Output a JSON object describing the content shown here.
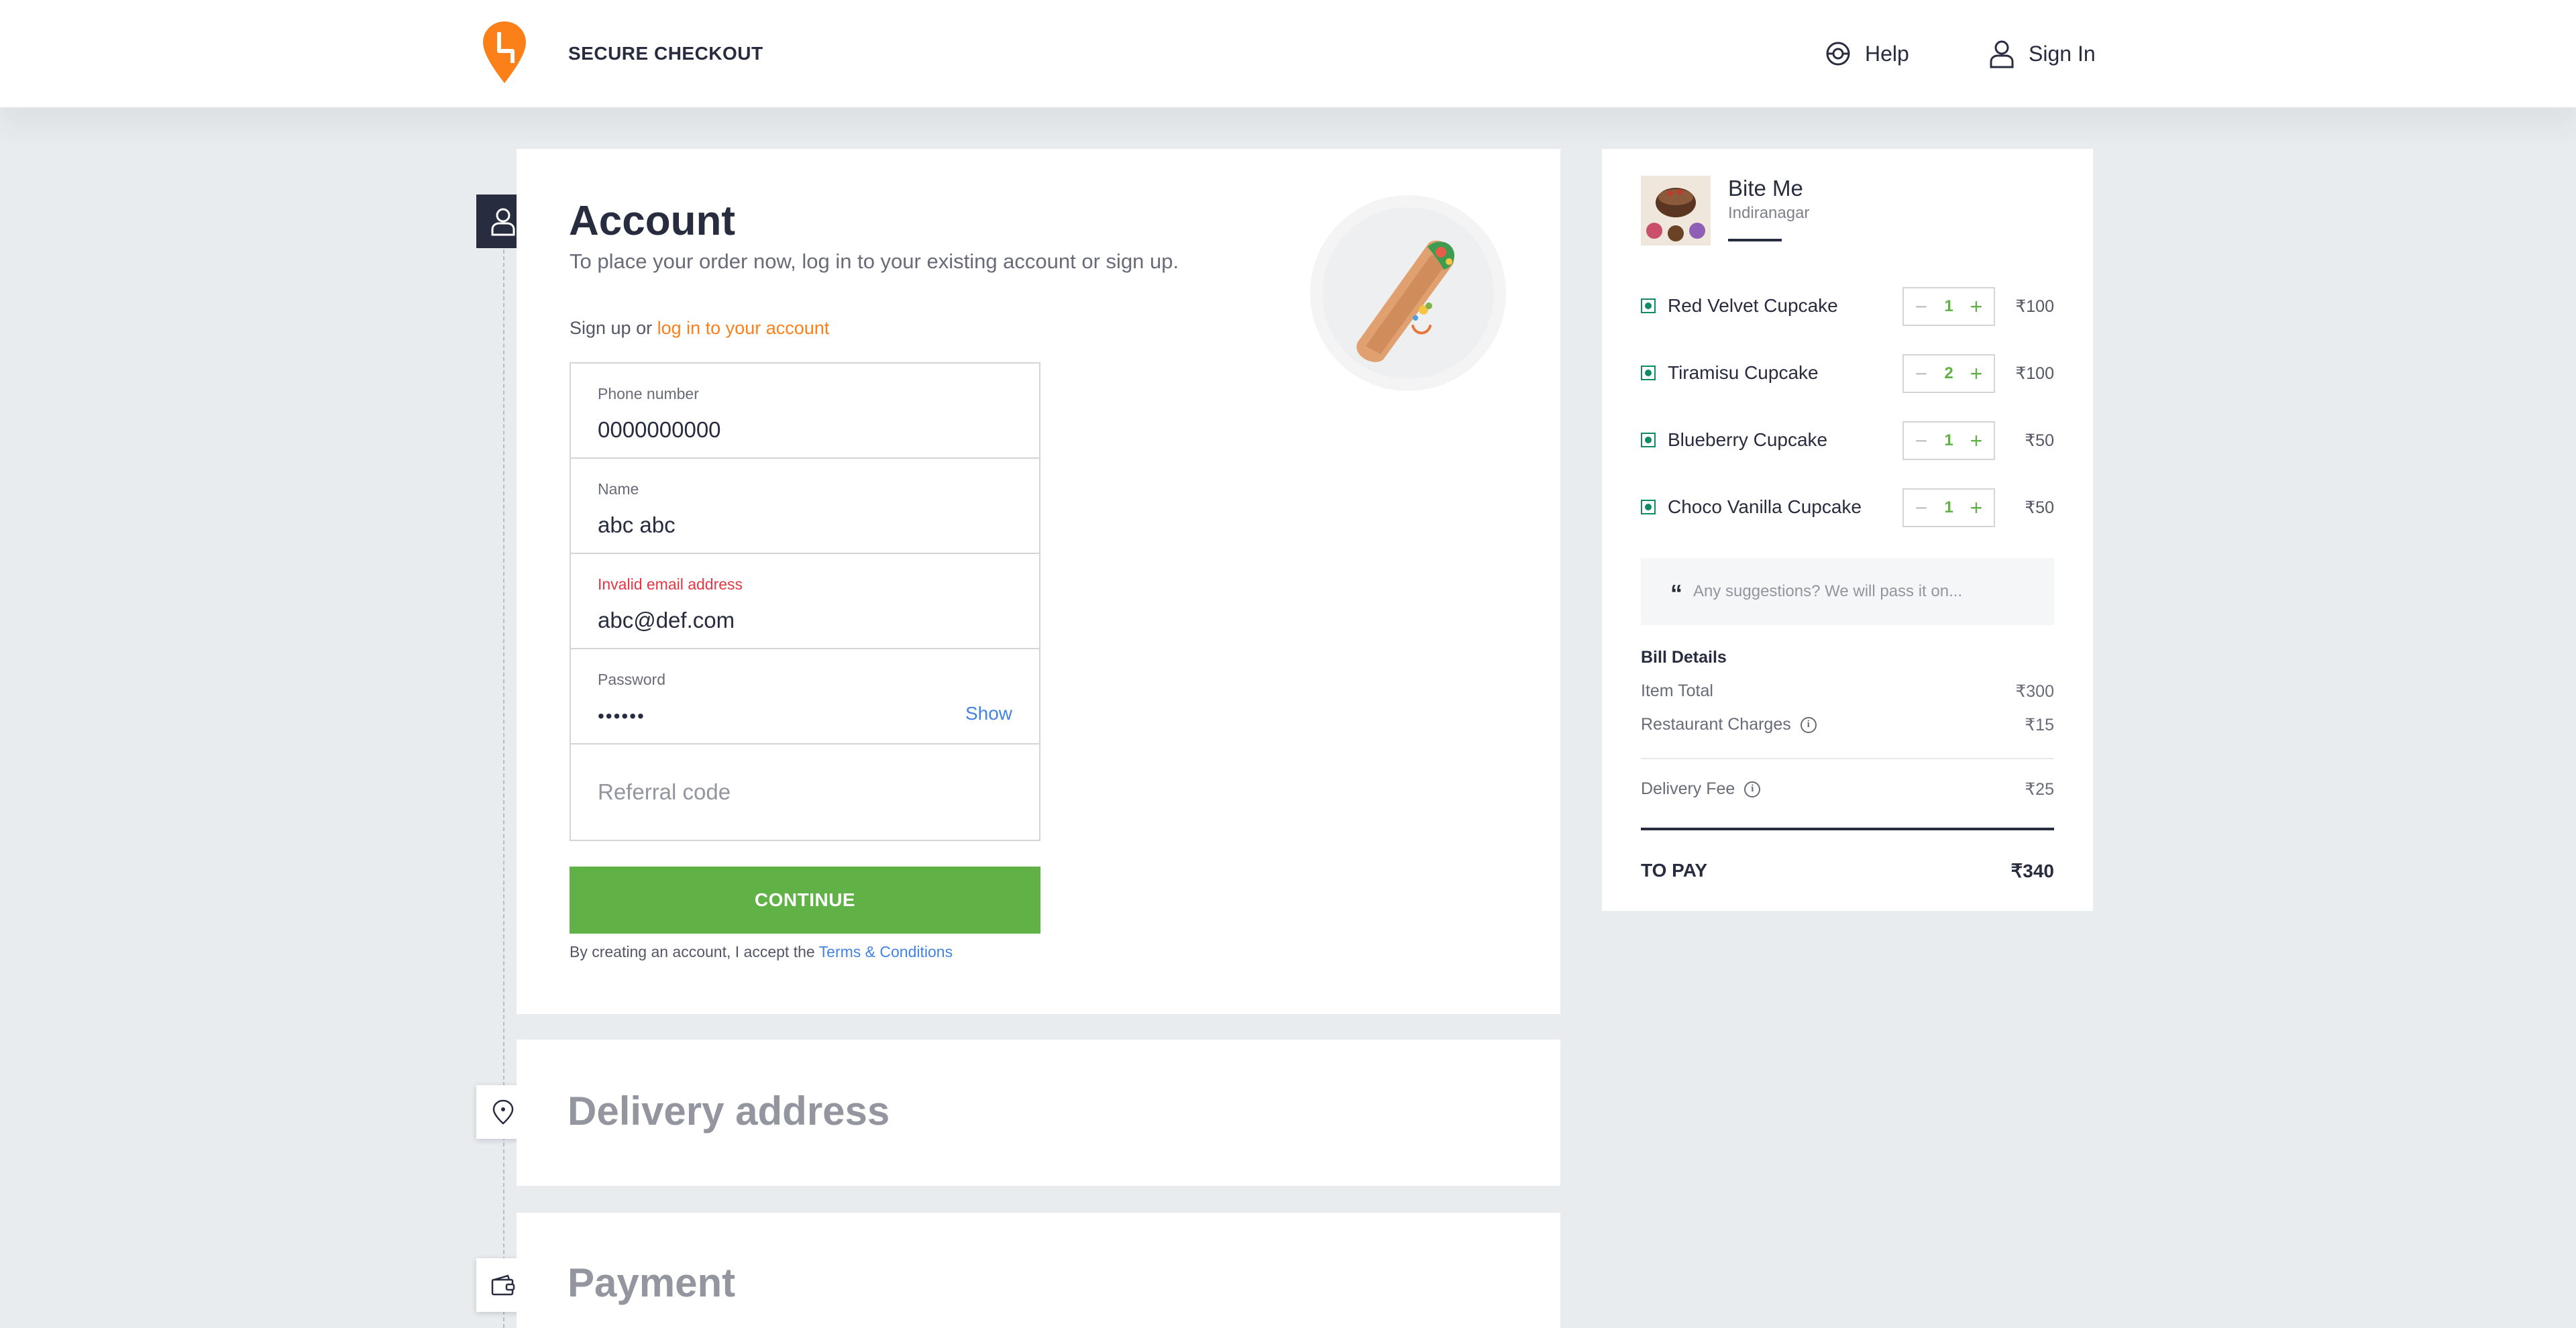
{
  "header": {
    "brand_title": "SECURE CHECKOUT",
    "help_label": "Help",
    "signin_label": "Sign In",
    "brand_color": "#fc8019"
  },
  "account": {
    "title": "Account",
    "subtitle": "To place your order now, log in to your existing account or sign up.",
    "signup_prefix": "Sign up or",
    "login_link": "log in to your account",
    "fields": {
      "phone": {
        "label": "Phone number",
        "value": "0000000000"
      },
      "name": {
        "label": "Name",
        "value": "abc abc"
      },
      "email": {
        "label": "Invalid email address",
        "value": "abc@def.com",
        "error": true
      },
      "password": {
        "label": "Password",
        "value": "••••••",
        "toggle": "Show"
      },
      "referral": {
        "placeholder": "Referral code"
      }
    },
    "continue_label": "CONTINUE",
    "terms_prefix": "By creating an account, I accept the",
    "terms_link": "Terms & Conditions"
  },
  "steps": {
    "delivery_title": "Delivery address",
    "payment_title": "Payment"
  },
  "cart": {
    "restaurant_name": "Bite Me",
    "restaurant_area": "Indiranagar",
    "items": [
      {
        "name": "Red Velvet Cupcake",
        "qty": "1",
        "price": "₹100"
      },
      {
        "name": "Tiramisu Cupcake",
        "qty": "2",
        "price": "₹100"
      },
      {
        "name": "Blueberry Cupcake",
        "qty": "1",
        "price": "₹50"
      },
      {
        "name": "Choco Vanilla Cupcake",
        "qty": "1",
        "price": "₹50"
      }
    ],
    "suggestions_placeholder": "Any suggestions? We will pass it on...",
    "bill": {
      "title": "Bill Details",
      "item_total_label": "Item Total",
      "item_total": "₹300",
      "restaurant_charges_label": "Restaurant Charges",
      "restaurant_charges": "₹15",
      "delivery_fee_label": "Delivery Fee",
      "delivery_fee": "₹25",
      "to_pay_label": "TO PAY",
      "to_pay": "₹340"
    }
  }
}
